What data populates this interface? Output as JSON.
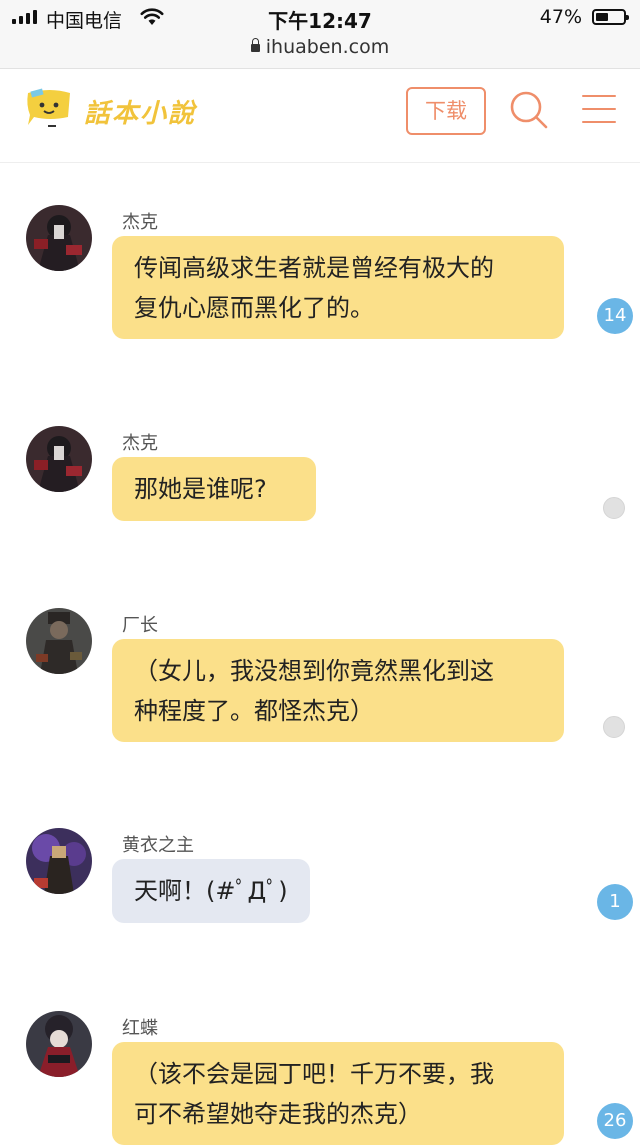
{
  "status_bar": {
    "carrier": "中国电信",
    "time": "下午12:47",
    "battery_pct": "47%",
    "battery_level": 0.47,
    "url": "ihuaben.com"
  },
  "header": {
    "logo_text": "話本小說",
    "download_label": "下载",
    "search_icon": "search-icon",
    "menu_icon": "hamburger-menu-icon",
    "accent_color": "#ef8e6a"
  },
  "messages": [
    {
      "name": "杰克",
      "text": [
        "传闻高级求生者就是曾经有极大的",
        "复仇心愿而黑化了的。"
      ],
      "style": "yellow",
      "badge": "14"
    },
    {
      "name": "杰克",
      "text": [
        "那她是谁呢?"
      ],
      "style": "yellow",
      "badge": ""
    },
    {
      "name": "厂长",
      "text": [
        "（女儿，我没想到你竟然黑化到这",
        "种程度了。都怪杰克）"
      ],
      "style": "yellow",
      "badge": ""
    },
    {
      "name": "黄衣之主",
      "text": [
        "天啊！(#ﾟДﾟ)"
      ],
      "style": "gray",
      "badge": "1"
    },
    {
      "name": "红蝶",
      "text": [
        "（该不会是园丁吧！千万不要，我",
        "可不希望她夺走我的杰克）"
      ],
      "style": "yellow",
      "badge": "26"
    }
  ]
}
